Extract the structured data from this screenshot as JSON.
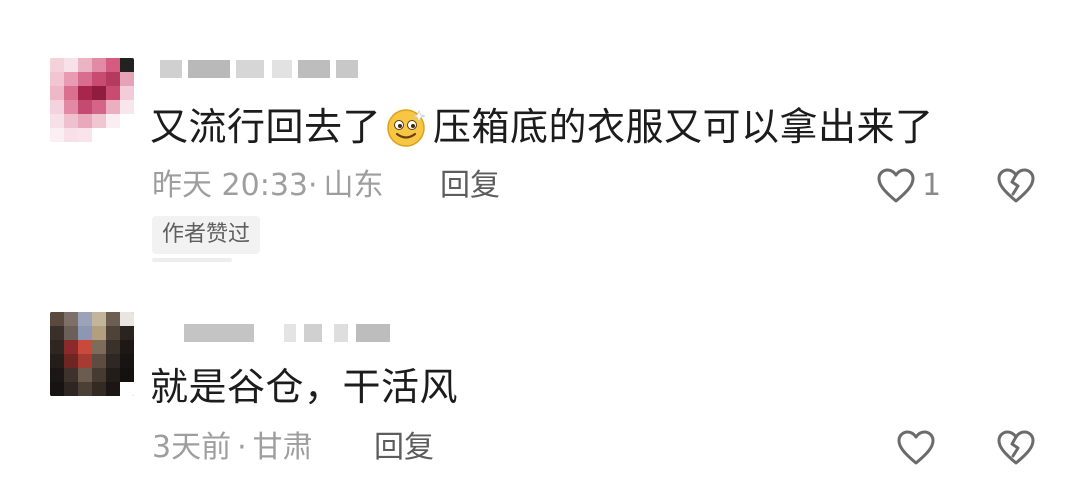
{
  "comments": [
    {
      "text_before_emoji": "又流行回去了",
      "emoji": "smiley-icon",
      "text_after_emoji": "压箱底的衣服又可以拿出来了",
      "time": "昨天 20:33",
      "location": "山东",
      "reply_label": "回复",
      "like_count": "1",
      "author_badge": "作者赞过"
    },
    {
      "text": "就是谷仓，干活风",
      "time": "3天前",
      "location": "甘肃",
      "reply_label": "回复"
    }
  ],
  "separator": "·",
  "colors": {
    "text": "#1c1c1c",
    "meta": "#9e9e9e",
    "badge_bg": "#f2f2f2",
    "icon": "#6b6b6b"
  }
}
